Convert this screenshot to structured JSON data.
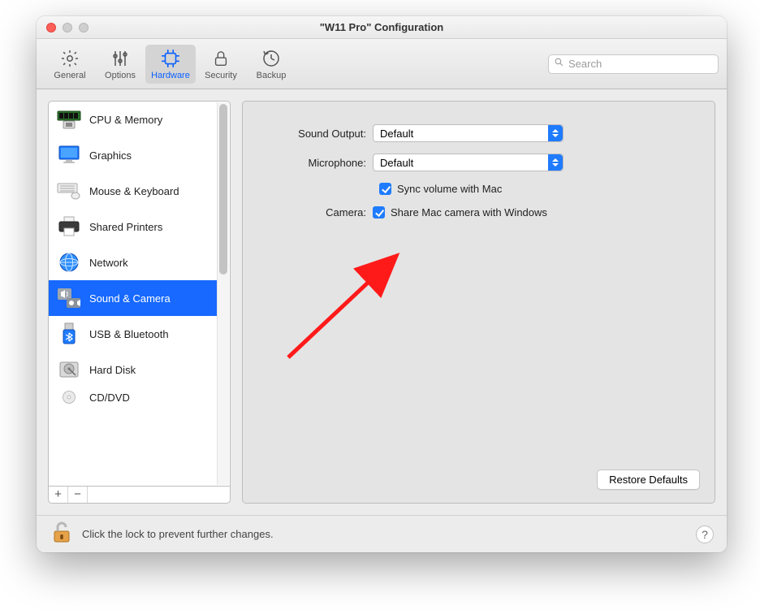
{
  "window": {
    "title": "\"W11 Pro\" Configuration"
  },
  "toolbar": {
    "items": [
      {
        "label": "General"
      },
      {
        "label": "Options"
      },
      {
        "label": "Hardware"
      },
      {
        "label": "Security"
      },
      {
        "label": "Backup"
      }
    ],
    "selected_index": 2,
    "search_placeholder": "Search"
  },
  "sidebar": {
    "items": [
      {
        "label": "CPU & Memory"
      },
      {
        "label": "Graphics"
      },
      {
        "label": "Mouse & Keyboard"
      },
      {
        "label": "Shared Printers"
      },
      {
        "label": "Network"
      },
      {
        "label": "Sound & Camera"
      },
      {
        "label": "USB & Bluetooth"
      },
      {
        "label": "Hard Disk"
      },
      {
        "label": "CD/DVD"
      }
    ],
    "selected_index": 5
  },
  "content": {
    "sound_output": {
      "label": "Sound Output:",
      "value": "Default"
    },
    "microphone": {
      "label": "Microphone:",
      "value": "Default"
    },
    "sync_volume": {
      "label": "Sync volume with Mac",
      "checked": true
    },
    "camera_label": "Camera:",
    "share_camera": {
      "label": "Share Mac camera with Windows",
      "checked": true
    },
    "restore_label": "Restore Defaults"
  },
  "footer": {
    "lock_text": "Click the lock to prevent further changes.",
    "help": "?"
  }
}
